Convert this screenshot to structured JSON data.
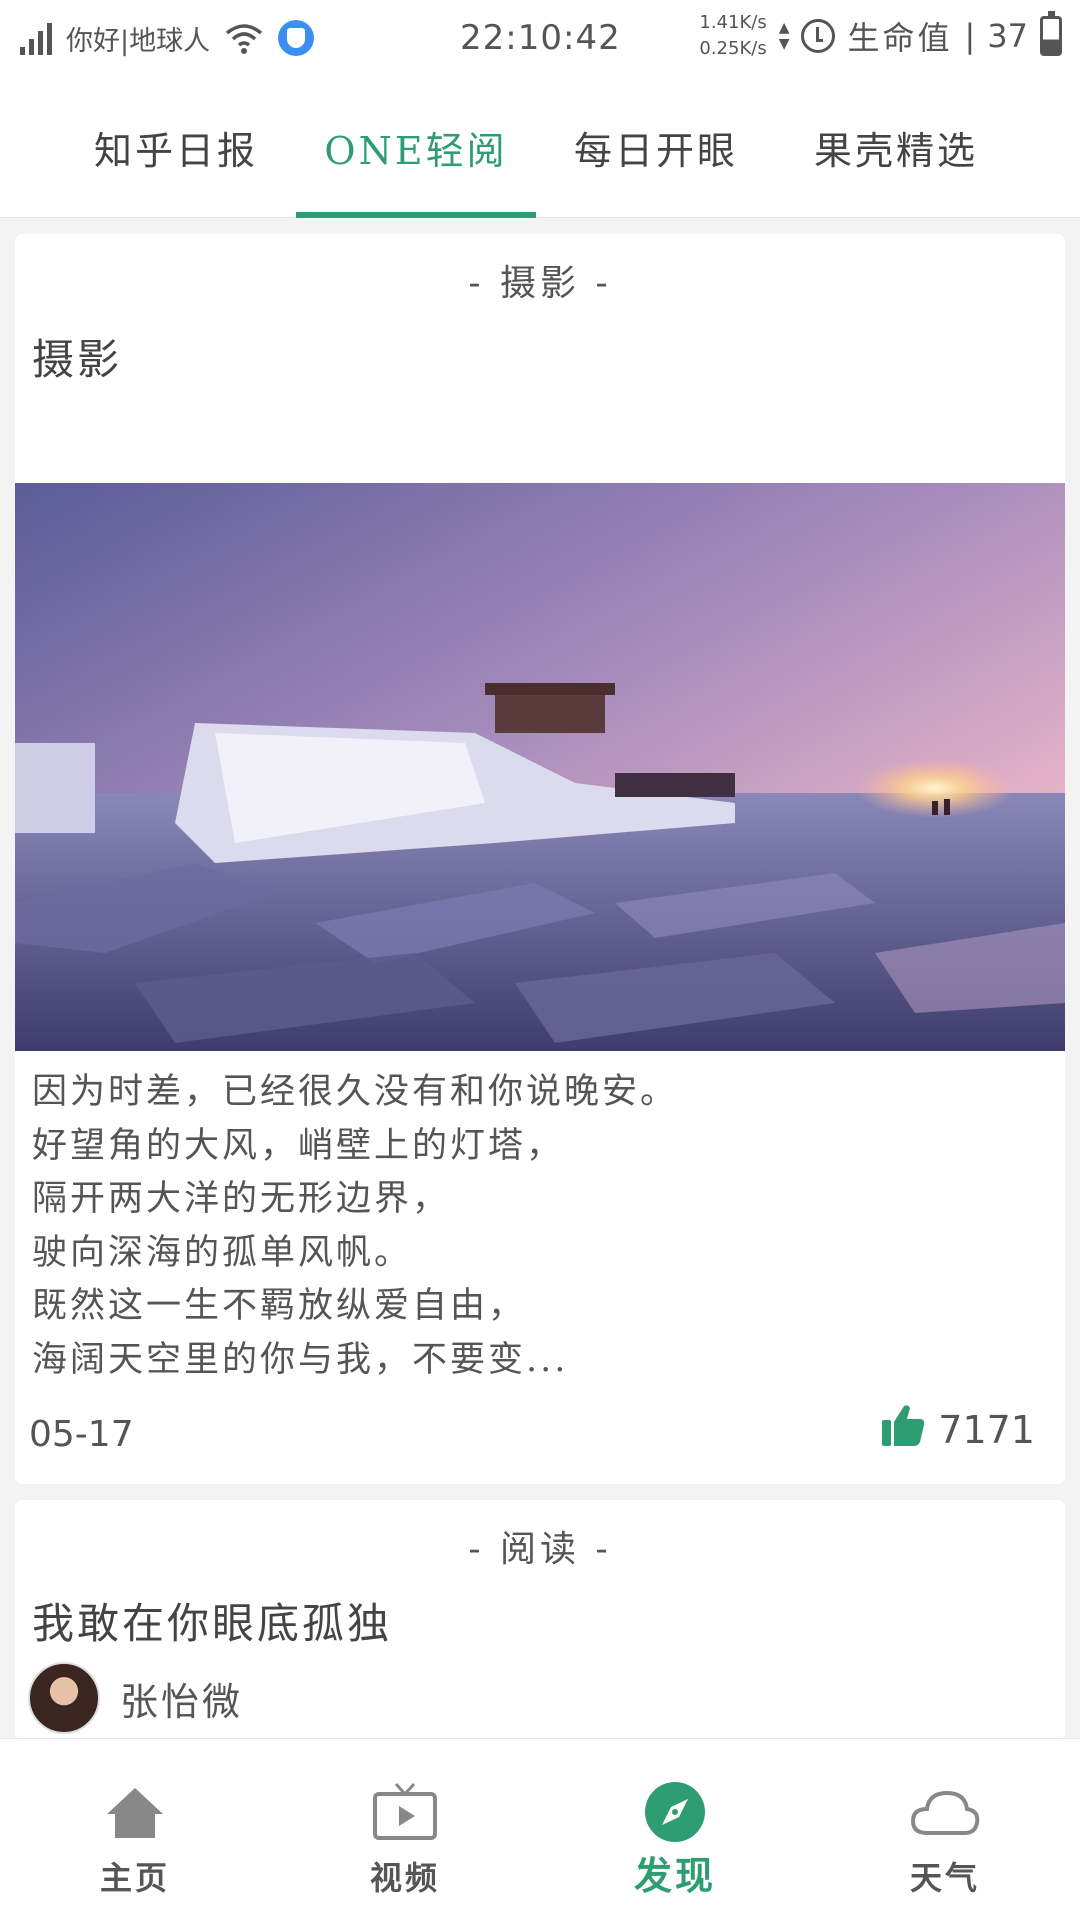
{
  "status_bar": {
    "carrier": "你好|地球人",
    "time": "22:10:42",
    "net_up": "1.41K/s",
    "net_down": "0.25K/s",
    "life_label": "生命值",
    "separator": "|",
    "battery": "37"
  },
  "top_tabs": [
    {
      "label": "知乎日报",
      "active": false
    },
    {
      "label": "ONE轻阅",
      "active": true
    },
    {
      "label": "每日开眼",
      "active": false
    },
    {
      "label": "果壳精选",
      "active": false
    }
  ],
  "cards": [
    {
      "category": "- 摄影 -",
      "title": "摄影",
      "image_alt": "frozen ship on ice at sunset",
      "excerpt": [
        "因为时差，已经很久没有和你说晚安。",
        "好望角的大风，峭壁上的灯塔，",
        "隔开两大洋的无形边界，",
        "驶向深海的孤单风帆。",
        "既然这一生不羁放纵爱自由，",
        "海阔天空里的你与我，不要变..."
      ],
      "date": "05-17",
      "likes": "7171"
    },
    {
      "category": "- 阅读 -",
      "title": "我敢在你眼底孤独",
      "author": "张怡微"
    }
  ],
  "bottom_nav": [
    {
      "label": "主页",
      "icon": "home-icon",
      "active": false
    },
    {
      "label": "视频",
      "icon": "tv-icon",
      "active": false
    },
    {
      "label": "发现",
      "icon": "compass-icon",
      "active": true
    },
    {
      "label": "天气",
      "icon": "cloud-icon",
      "active": false
    }
  ],
  "colors": {
    "accent": "#2f9d74",
    "text": "#444444",
    "background": "#f3f3f3"
  }
}
